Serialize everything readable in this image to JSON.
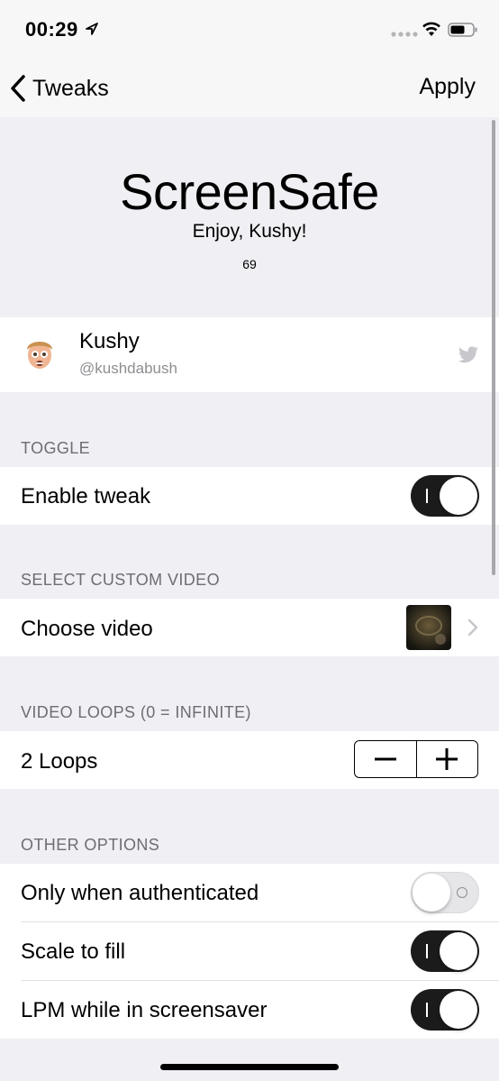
{
  "status_bar": {
    "time": "00:29"
  },
  "nav": {
    "back_label": "Tweaks",
    "apply_label": "Apply"
  },
  "header": {
    "title": "ScreenSafe",
    "subtitle": "Enjoy, Kushy!",
    "number": "69"
  },
  "developer": {
    "name": "Kushy",
    "handle": "@kushdabush",
    "icon": "twitter-icon"
  },
  "sections": {
    "toggle": {
      "header": "TOGGLE",
      "enable_label": "Enable tweak",
      "enable_on": true
    },
    "video": {
      "header": "SELECT CUSTOM VIDEO",
      "choose_label": "Choose video"
    },
    "loops": {
      "header": "VIDEO LOOPS (0 = INFINITE)",
      "value_label": "2 Loops"
    },
    "other": {
      "header": "OTHER OPTIONS",
      "items": [
        {
          "label": "Only when authenticated",
          "on": false
        },
        {
          "label": "Scale to fill",
          "on": true
        },
        {
          "label": "LPM while in screensaver",
          "on": true
        }
      ]
    }
  },
  "colors": {
    "background": "#efeff4",
    "switch_on": "#1b1b1b",
    "twitter_gray": "#c7c7cc"
  }
}
